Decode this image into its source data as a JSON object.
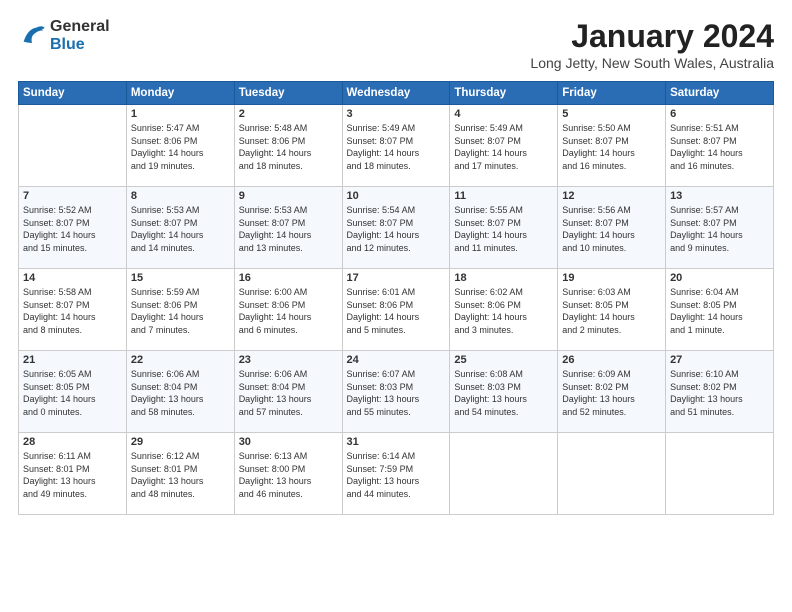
{
  "logo": {
    "general": "General",
    "blue": "Blue"
  },
  "title": "January 2024",
  "location": "Long Jetty, New South Wales, Australia",
  "days_of_week": [
    "Sunday",
    "Monday",
    "Tuesday",
    "Wednesday",
    "Thursday",
    "Friday",
    "Saturday"
  ],
  "weeks": [
    [
      {
        "day": "",
        "info": ""
      },
      {
        "day": "1",
        "info": "Sunrise: 5:47 AM\nSunset: 8:06 PM\nDaylight: 14 hours\nand 19 minutes."
      },
      {
        "day": "2",
        "info": "Sunrise: 5:48 AM\nSunset: 8:06 PM\nDaylight: 14 hours\nand 18 minutes."
      },
      {
        "day": "3",
        "info": "Sunrise: 5:49 AM\nSunset: 8:07 PM\nDaylight: 14 hours\nand 18 minutes."
      },
      {
        "day": "4",
        "info": "Sunrise: 5:49 AM\nSunset: 8:07 PM\nDaylight: 14 hours\nand 17 minutes."
      },
      {
        "day": "5",
        "info": "Sunrise: 5:50 AM\nSunset: 8:07 PM\nDaylight: 14 hours\nand 16 minutes."
      },
      {
        "day": "6",
        "info": "Sunrise: 5:51 AM\nSunset: 8:07 PM\nDaylight: 14 hours\nand 16 minutes."
      }
    ],
    [
      {
        "day": "7",
        "info": "Sunrise: 5:52 AM\nSunset: 8:07 PM\nDaylight: 14 hours\nand 15 minutes."
      },
      {
        "day": "8",
        "info": "Sunrise: 5:53 AM\nSunset: 8:07 PM\nDaylight: 14 hours\nand 14 minutes."
      },
      {
        "day": "9",
        "info": "Sunrise: 5:53 AM\nSunset: 8:07 PM\nDaylight: 14 hours\nand 13 minutes."
      },
      {
        "day": "10",
        "info": "Sunrise: 5:54 AM\nSunset: 8:07 PM\nDaylight: 14 hours\nand 12 minutes."
      },
      {
        "day": "11",
        "info": "Sunrise: 5:55 AM\nSunset: 8:07 PM\nDaylight: 14 hours\nand 11 minutes."
      },
      {
        "day": "12",
        "info": "Sunrise: 5:56 AM\nSunset: 8:07 PM\nDaylight: 14 hours\nand 10 minutes."
      },
      {
        "day": "13",
        "info": "Sunrise: 5:57 AM\nSunset: 8:07 PM\nDaylight: 14 hours\nand 9 minutes."
      }
    ],
    [
      {
        "day": "14",
        "info": "Sunrise: 5:58 AM\nSunset: 8:07 PM\nDaylight: 14 hours\nand 8 minutes."
      },
      {
        "day": "15",
        "info": "Sunrise: 5:59 AM\nSunset: 8:06 PM\nDaylight: 14 hours\nand 7 minutes."
      },
      {
        "day": "16",
        "info": "Sunrise: 6:00 AM\nSunset: 8:06 PM\nDaylight: 14 hours\nand 6 minutes."
      },
      {
        "day": "17",
        "info": "Sunrise: 6:01 AM\nSunset: 8:06 PM\nDaylight: 14 hours\nand 5 minutes."
      },
      {
        "day": "18",
        "info": "Sunrise: 6:02 AM\nSunset: 8:06 PM\nDaylight: 14 hours\nand 3 minutes."
      },
      {
        "day": "19",
        "info": "Sunrise: 6:03 AM\nSunset: 8:05 PM\nDaylight: 14 hours\nand 2 minutes."
      },
      {
        "day": "20",
        "info": "Sunrise: 6:04 AM\nSunset: 8:05 PM\nDaylight: 14 hours\nand 1 minute."
      }
    ],
    [
      {
        "day": "21",
        "info": "Sunrise: 6:05 AM\nSunset: 8:05 PM\nDaylight: 14 hours\nand 0 minutes."
      },
      {
        "day": "22",
        "info": "Sunrise: 6:06 AM\nSunset: 8:04 PM\nDaylight: 13 hours\nand 58 minutes."
      },
      {
        "day": "23",
        "info": "Sunrise: 6:06 AM\nSunset: 8:04 PM\nDaylight: 13 hours\nand 57 minutes."
      },
      {
        "day": "24",
        "info": "Sunrise: 6:07 AM\nSunset: 8:03 PM\nDaylight: 13 hours\nand 55 minutes."
      },
      {
        "day": "25",
        "info": "Sunrise: 6:08 AM\nSunset: 8:03 PM\nDaylight: 13 hours\nand 54 minutes."
      },
      {
        "day": "26",
        "info": "Sunrise: 6:09 AM\nSunset: 8:02 PM\nDaylight: 13 hours\nand 52 minutes."
      },
      {
        "day": "27",
        "info": "Sunrise: 6:10 AM\nSunset: 8:02 PM\nDaylight: 13 hours\nand 51 minutes."
      }
    ],
    [
      {
        "day": "28",
        "info": "Sunrise: 6:11 AM\nSunset: 8:01 PM\nDaylight: 13 hours\nand 49 minutes."
      },
      {
        "day": "29",
        "info": "Sunrise: 6:12 AM\nSunset: 8:01 PM\nDaylight: 13 hours\nand 48 minutes."
      },
      {
        "day": "30",
        "info": "Sunrise: 6:13 AM\nSunset: 8:00 PM\nDaylight: 13 hours\nand 46 minutes."
      },
      {
        "day": "31",
        "info": "Sunrise: 6:14 AM\nSunset: 7:59 PM\nDaylight: 13 hours\nand 44 minutes."
      },
      {
        "day": "",
        "info": ""
      },
      {
        "day": "",
        "info": ""
      },
      {
        "day": "",
        "info": ""
      }
    ]
  ]
}
